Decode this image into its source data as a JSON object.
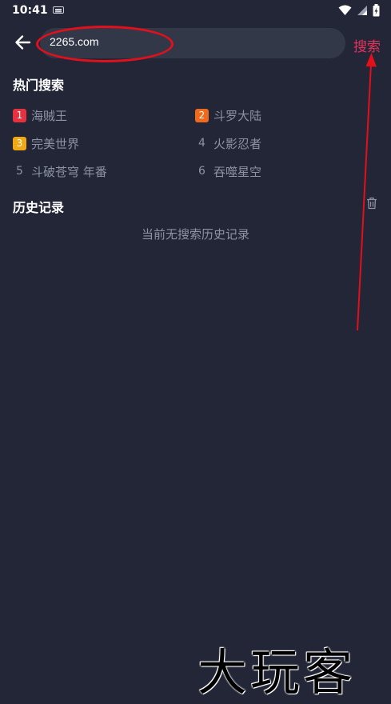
{
  "status_bar": {
    "time": "10:41"
  },
  "search": {
    "value": "2265.com",
    "button_label": "搜索"
  },
  "hot_search": {
    "title": "热门搜索",
    "items": [
      {
        "rank": "1",
        "label": "海贼王"
      },
      {
        "rank": "2",
        "label": "斗罗大陆"
      },
      {
        "rank": "3",
        "label": "完美世界"
      },
      {
        "rank": "4",
        "label": "火影忍者"
      },
      {
        "rank": "5",
        "label": "斗破苍穹 年番"
      },
      {
        "rank": "6",
        "label": "吞噬星空"
      }
    ]
  },
  "history": {
    "title": "历史记录",
    "empty_text": "当前无搜索历史记录"
  },
  "watermark": "大玩客",
  "colors": {
    "background": "#222636",
    "accent": "#e8325a",
    "annotation": "#e30f1b",
    "rank_1": "#e6323e",
    "rank_2": "#f06a1d",
    "rank_3": "#f2a812"
  },
  "icons": [
    "back-arrow-icon",
    "trash-icon",
    "keyboard-icon",
    "wifi-icon",
    "signal-icon",
    "battery-icon"
  ]
}
